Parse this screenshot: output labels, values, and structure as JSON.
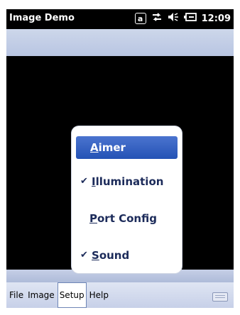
{
  "status_bar": {
    "app_title": "Image Demo",
    "alpha_indicator": "a",
    "icons": [
      "data-sync-icon",
      "volume-icon",
      "battery-charging-icon"
    ],
    "time": "12:09"
  },
  "popup_menu": {
    "items": [
      {
        "label": "Aimer",
        "checked": false,
        "selected": true
      },
      {
        "label": "Illumination",
        "checked": true,
        "selected": false
      },
      {
        "label": "Port Config",
        "checked": false,
        "selected": false
      },
      {
        "label": "Sound",
        "checked": true,
        "selected": false
      }
    ],
    "check_glyph": "✔"
  },
  "menu_bar": {
    "items": [
      {
        "label": "File"
      },
      {
        "label": "Image"
      },
      {
        "label": "Setup",
        "active": true
      },
      {
        "label": "Help"
      }
    ]
  },
  "colors": {
    "selected_item": "#2452b5",
    "menu_bar": "#c7d0e8",
    "strip": "#b8c5e2"
  }
}
